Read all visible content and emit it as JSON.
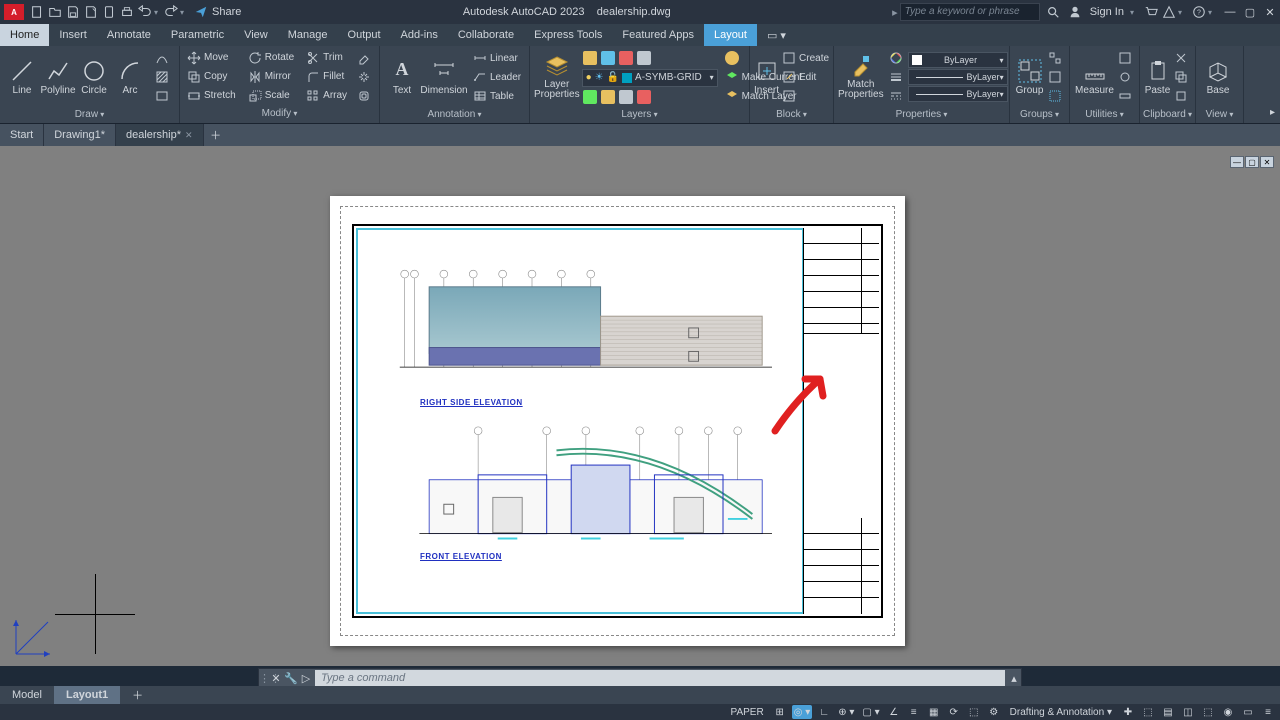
{
  "title": {
    "app": "Autodesk AutoCAD 2023",
    "file": "dealership.dwg"
  },
  "qat": {
    "share": "Share"
  },
  "search": {
    "placeholder": "Type a keyword or phrase"
  },
  "signin": "Sign In",
  "menu": [
    "Home",
    "Insert",
    "Annotate",
    "Parametric",
    "View",
    "Manage",
    "Output",
    "Add-ins",
    "Collaborate",
    "Express Tools",
    "Featured Apps",
    "Layout"
  ],
  "ribbon": {
    "draw": {
      "title": "Draw",
      "line": "Line",
      "polyline": "Polyline",
      "circle": "Circle",
      "arc": "Arc"
    },
    "modify": {
      "title": "Modify",
      "move": "Move",
      "rotate": "Rotate",
      "trim": "Trim",
      "copy": "Copy",
      "mirror": "Mirror",
      "fillet": "Fillet",
      "stretch": "Stretch",
      "scale": "Scale",
      "array": "Array"
    },
    "annotation": {
      "title": "Annotation",
      "text": "Text",
      "dimension": "Dimension",
      "linear": "Linear",
      "leader": "Leader",
      "table": "Table"
    },
    "layers": {
      "title": "Layers",
      "props": "Layer\nProperties",
      "current": "A-SYMB-GRID",
      "makecur": "Make Current",
      "matchlay": "Match Layer"
    },
    "block": {
      "title": "Block",
      "insert": "Insert",
      "create": "Create",
      "edit": "Edit"
    },
    "properties": {
      "title": "Properties",
      "match": "Match\nProperties",
      "bylayer1": "ByLayer",
      "bylayer2": "ByLayer",
      "bylayer3": "ByLayer"
    },
    "groups": {
      "title": "Groups",
      "group": "Group"
    },
    "utilities": {
      "title": "Utilities",
      "measure": "Measure"
    },
    "clipboard": {
      "title": "Clipboard",
      "paste": "Paste"
    },
    "view": {
      "title": "View",
      "base": "Base"
    }
  },
  "filetabs": {
    "start": "Start",
    "d1": "Drawing1*",
    "d2": "dealership*"
  },
  "paper": {
    "elev1": "RIGHT SIDE ELEVATION",
    "elev2": "FRONT ELEVATION"
  },
  "cmd": {
    "placeholder": "Type a command"
  },
  "layouts": {
    "model": "Model",
    "l1": "Layout1"
  },
  "status": {
    "space": "PAPER",
    "ws": "Drafting & Annotation"
  }
}
